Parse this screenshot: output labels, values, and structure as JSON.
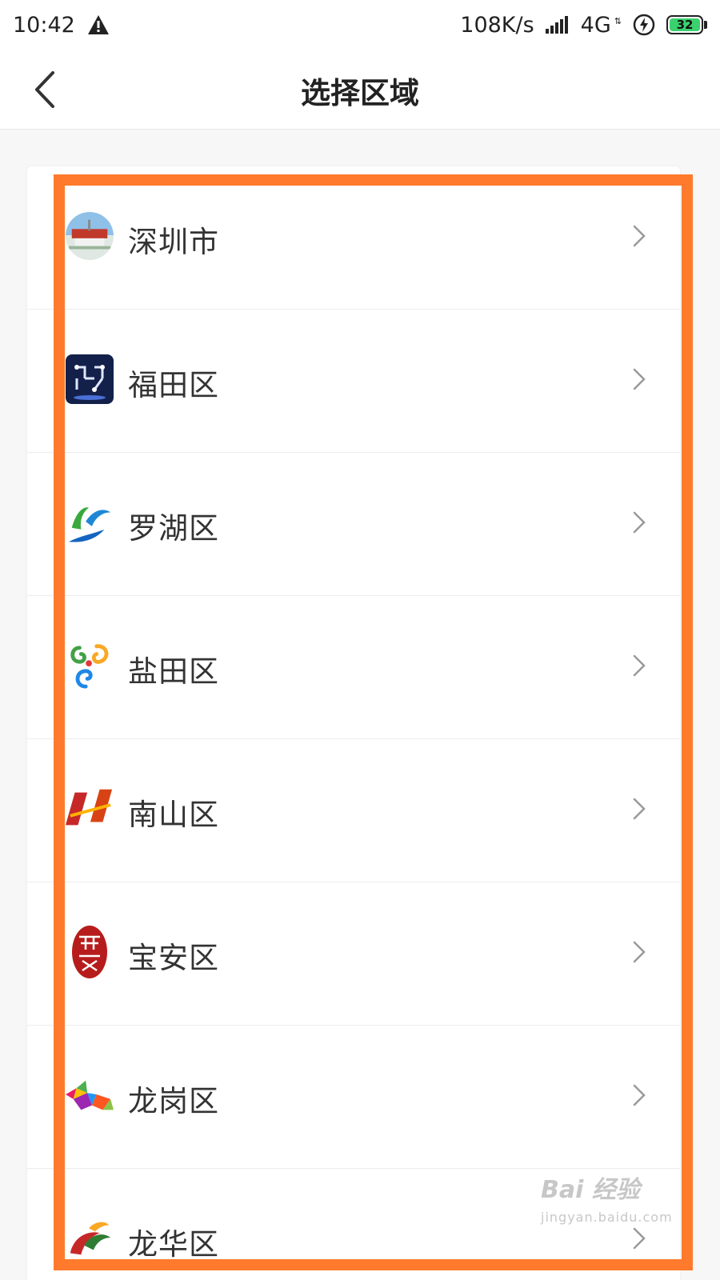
{
  "status_bar": {
    "time": "10:42",
    "network_speed": "108K/s",
    "network_type": "4G",
    "battery_level": "32",
    "icons": [
      "warning-icon",
      "signal-icon",
      "charging-bolt-icon",
      "battery-icon"
    ]
  },
  "nav": {
    "title": "选择区域",
    "back_icon": "chevron-left-icon"
  },
  "regions": [
    {
      "name": "深圳市",
      "icon": "shenzhen-city-logo"
    },
    {
      "name": "福田区",
      "icon": "futian-district-logo"
    },
    {
      "name": "罗湖区",
      "icon": "luohu-district-logo"
    },
    {
      "name": "盐田区",
      "icon": "yantian-district-logo"
    },
    {
      "name": "南山区",
      "icon": "nanshan-district-logo"
    },
    {
      "name": "宝安区",
      "icon": "baoan-district-logo"
    },
    {
      "name": "龙岗区",
      "icon": "longgang-district-logo"
    },
    {
      "name": "龙华区",
      "icon": "longhua-district-logo"
    }
  ],
  "highlight": {
    "color": "#ff7a2c"
  },
  "watermark": {
    "brand": "Bai 经验",
    "url": "jingyan.baidu.com"
  }
}
